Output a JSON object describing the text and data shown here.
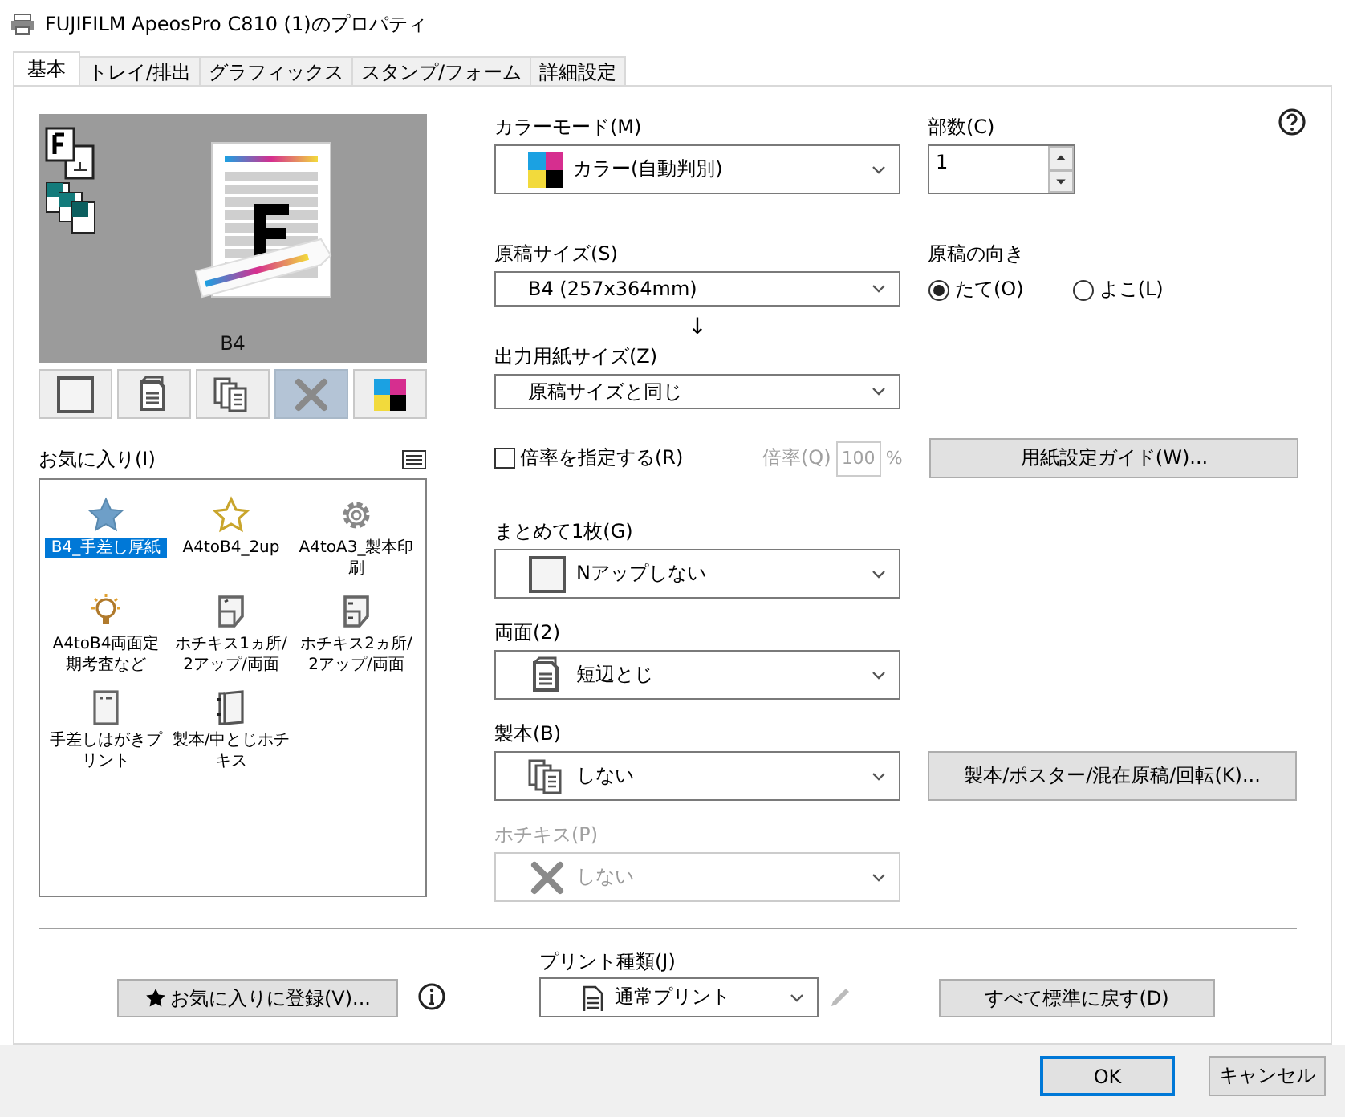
{
  "window": {
    "title": "FUJIFILM ApeosPro C810 (1)のプロパティ"
  },
  "tabs": [
    {
      "label": "基本",
      "selected": true
    },
    {
      "label": "トレイ/排出",
      "selected": false
    },
    {
      "label": "グラフィックス",
      "selected": false
    },
    {
      "label": "スタンプ/フォーム",
      "selected": false
    },
    {
      "label": "詳細設定",
      "selected": false
    }
  ],
  "preview": {
    "paper_size": "B4"
  },
  "view_buttons": [
    {
      "kind": "blank",
      "selected": false
    },
    {
      "kind": "duplex",
      "selected": false
    },
    {
      "kind": "booklet",
      "selected": false
    },
    {
      "kind": "staple",
      "selected": true
    },
    {
      "kind": "color",
      "selected": false
    }
  ],
  "favorites": {
    "label": "お気に入り(I)",
    "items": [
      {
        "label": "B4_手差し厚紙",
        "kind": "star-filled",
        "selected": true
      },
      {
        "label": "A4toB4_2up",
        "kind": "star",
        "selected": false
      },
      {
        "label": "A4toA3_製本印刷",
        "kind": "gear",
        "selected": false
      },
      {
        "label": "A4toB4両面定期考査など",
        "kind": "bulb",
        "selected": false
      },
      {
        "label": "ホチキス1ヵ所/2アップ/両面",
        "kind": "staple1",
        "selected": false
      },
      {
        "label": "ホチキス2ヵ所/2アップ/両面",
        "kind": "staple2",
        "selected": false
      },
      {
        "label": "手差しはがきプリント",
        "kind": "postcard",
        "selected": false
      },
      {
        "label": "製本/中とじホチキス",
        "kind": "booklet",
        "selected": false
      }
    ]
  },
  "color_mode": {
    "label": "カラーモード(M)",
    "value": "カラー(自動判別)",
    "kind": "color"
  },
  "copies": {
    "label": "部数(C)",
    "value": "1"
  },
  "original_size": {
    "label": "原稿サイズ(S)",
    "value": "B4 (257x364mm)"
  },
  "orientation": {
    "label": "原稿の向き",
    "options": [
      {
        "label": "たて(O)",
        "selected": true
      },
      {
        "label": "よこ(L)",
        "selected": false
      }
    ]
  },
  "output_size": {
    "label": "出力用紙サイズ(Z)",
    "value": "原稿サイズと同じ"
  },
  "arrow": "↓",
  "scale": {
    "label": "倍率を指定する(R)",
    "checked": false,
    "ratio_label": "倍率(Q)",
    "ratio_value": "100",
    "unit": "%",
    "disabled": true
  },
  "paper_guide_button": "用紙設定ガイド(W)...",
  "nup": {
    "label": "まとめて1枚(G)",
    "value": "Nアップしない",
    "kind": "blank",
    "disabled": false
  },
  "duplex": {
    "label": "両面(2)",
    "value": "短辺とじ",
    "kind": "duplex",
    "disabled": false
  },
  "booklet": {
    "label": "製本(B)",
    "value": "しない",
    "kind": "booklet",
    "disabled": false
  },
  "booklet_button": "製本/ポスター/混在原稿/回転(K)...",
  "staple": {
    "label": "ホチキス(P)",
    "value": "しない",
    "kind": "staple",
    "disabled": true
  },
  "favorite_button": "お気に入りに登録(V)...",
  "print_type": {
    "label": "プリント種類(J)",
    "value": "通常プリント"
  },
  "reset_button": "すべて標準に戻す(D)",
  "dialog_buttons": [
    {
      "label": "OK",
      "default": true
    },
    {
      "label": "キャンセル",
      "default": false
    }
  ]
}
